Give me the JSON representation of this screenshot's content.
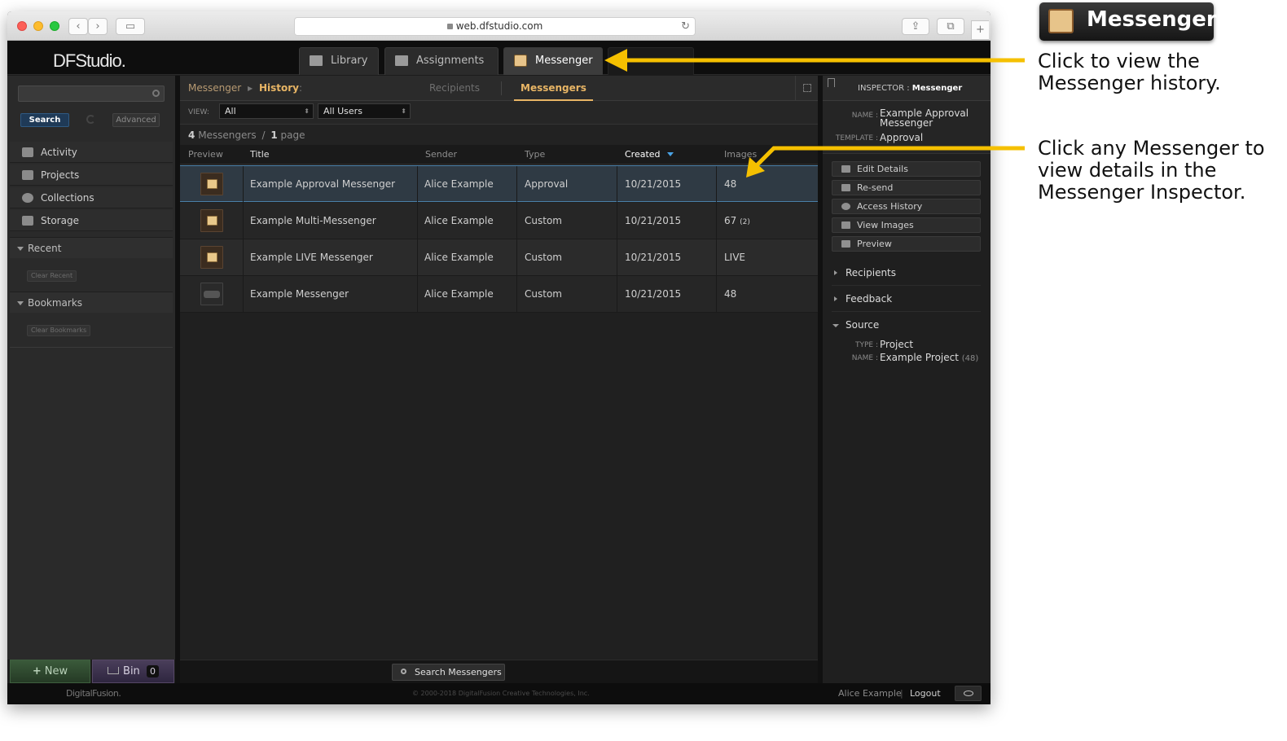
{
  "browser": {
    "url": "web.dfstudio.com",
    "back_glyph": "‹",
    "forward_glyph": "›",
    "sidebar_glyph": "▭",
    "reload_glyph": "↻",
    "share_glyph": "⇪",
    "tabs_glyph": "⧉",
    "newtab_glyph": "+"
  },
  "app": {
    "logo": "DFStudio.",
    "main_tabs": [
      {
        "label": "Library",
        "icon": "library-icon"
      },
      {
        "label": "Assignments",
        "icon": "assignments-icon"
      },
      {
        "label": "Messenger",
        "icon": "messenger-icon"
      }
    ]
  },
  "sidebar": {
    "search_button": "Search",
    "advanced_button": "Advanced",
    "nav_items": [
      "Activity",
      "Projects",
      "Collections",
      "Storage"
    ],
    "recent_label": "Recent",
    "clear_recent": "Clear Recent",
    "bookmarks_label": "Bookmarks",
    "clear_bookmarks": "Clear Bookmarks",
    "new_button": "New",
    "new_glyph": "+",
    "bin_button": "Bin",
    "bin_count": "0"
  },
  "center": {
    "crumb_root": "Messenger",
    "crumb_current": "History",
    "crumb_colon": ":",
    "crumb_sep": "▶",
    "tab_recipients": "Recipients",
    "tab_messengers": "Messengers",
    "view_label": "VIEW:",
    "view_value": "All",
    "users_value": "All Users",
    "select_arrow": "⬍",
    "count": "4",
    "count_label": "Messengers",
    "count_sep": "/",
    "pages": "1",
    "pages_label": "page",
    "columns": {
      "preview": "Preview",
      "title": "Title",
      "sender": "Sender",
      "type": "Type",
      "created": "Created",
      "images": "Images"
    },
    "rows": [
      {
        "title": "Example Approval Messenger",
        "sender": "Alice Example",
        "type": "Approval",
        "created": "10/21/2015",
        "images": "48",
        "images_extra": ""
      },
      {
        "title": "Example Multi-Messenger",
        "sender": "Alice Example",
        "type": "Custom",
        "created": "10/21/2015",
        "images": "67",
        "images_extra": "(2)"
      },
      {
        "title": "Example LIVE Messenger",
        "sender": "Alice Example",
        "type": "Custom",
        "created": "10/21/2015",
        "images": "LIVE",
        "images_extra": ""
      },
      {
        "title": "Example Messenger",
        "sender": "Alice Example",
        "type": "Custom",
        "created": "10/21/2015",
        "images": "48",
        "images_extra": ""
      }
    ],
    "search_messengers": "Search Messengers"
  },
  "inspector": {
    "heading_prefix": "INSPECTOR :",
    "heading_value": "Messenger",
    "name_label": "NAME :",
    "name_value_line1": "Example Approval",
    "name_value_line2": "Messenger",
    "template_label": "TEMPLATE :",
    "template_value": "Approval",
    "actions": [
      "Edit Details",
      "Re-send",
      "Access History",
      "View Images",
      "Preview"
    ],
    "sections": [
      "Recipients",
      "Feedback",
      "Source"
    ],
    "source_type_label": "TYPE :",
    "source_type_value": "Project",
    "source_name_label": "NAME :",
    "source_name_value": "Example Project",
    "source_name_count": "(48)"
  },
  "status": {
    "company": "DigitalFusion.",
    "copyright": "© 2000-2018 DigitalFusion Creative Technologies, Inc.",
    "user": "Alice Example",
    "sep": "|",
    "logout": "Logout"
  },
  "annotations": {
    "badge": "Messenger",
    "note1_line1": "Click to view the",
    "note1_line2": "Messenger history.",
    "note2_line1": "Click any Messenger to",
    "note2_line2": "view details in the",
    "note2_line3": "Messenger Inspector."
  },
  "colors": {
    "accent": "#f5c000",
    "selected_row": "#2f3a44",
    "active_crumb": "#e8b565"
  }
}
